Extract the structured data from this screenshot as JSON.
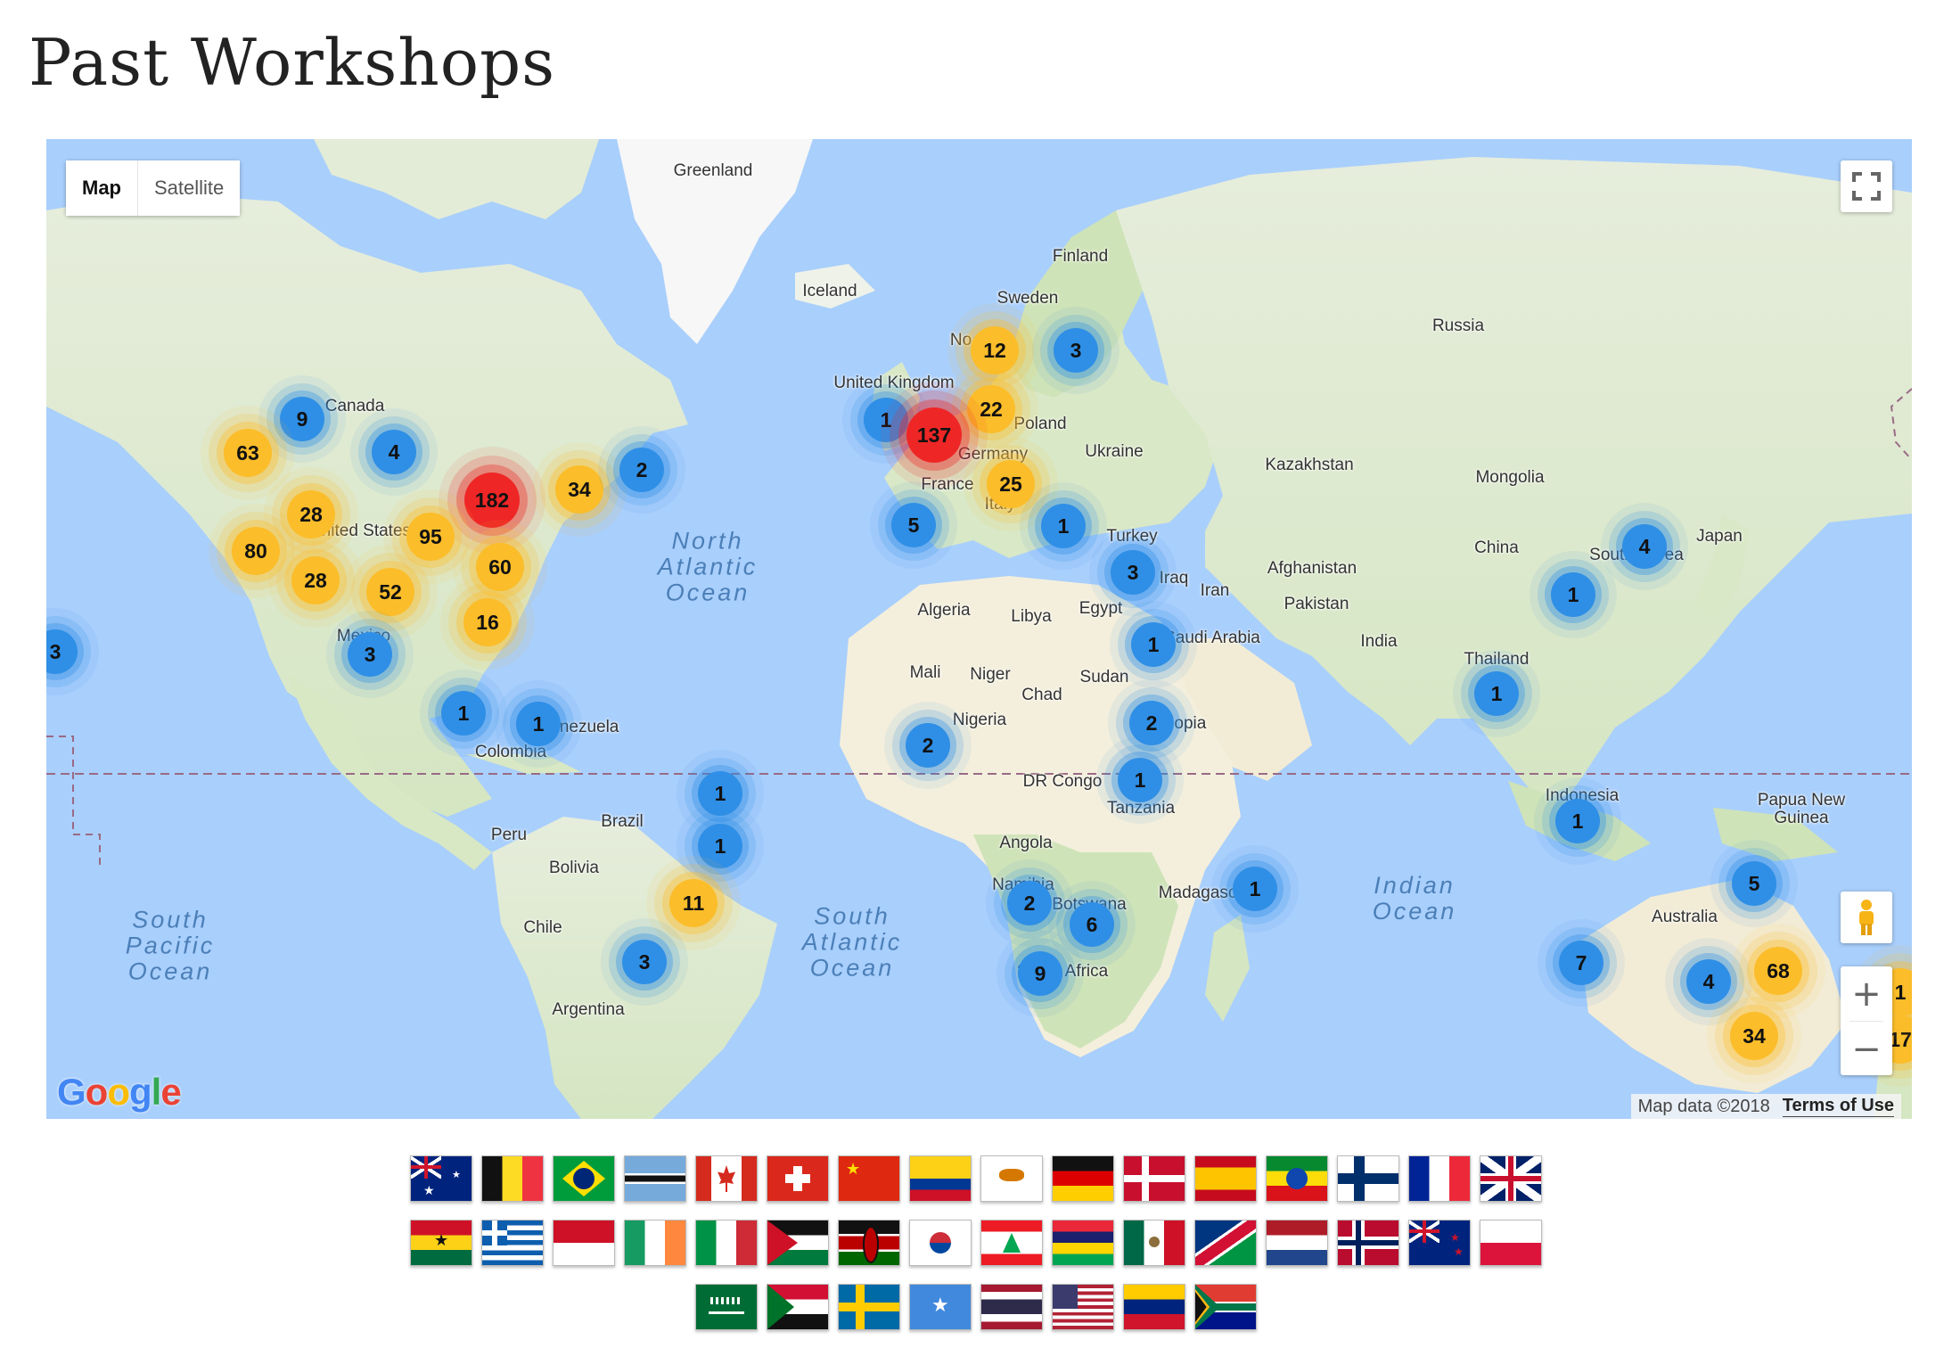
{
  "page": {
    "title": "Past Workshops"
  },
  "map": {
    "type_control": {
      "map_label": "Map",
      "satellite_label": "Satellite",
      "active": "Map"
    },
    "attribution": {
      "data": "Map data ©2018",
      "terms": "Terms of Use"
    },
    "logo_text": "Google",
    "places": [
      "Greenland",
      "Iceland",
      "Finland",
      "Sweden",
      "No",
      "Russia",
      "United Kingdom",
      "Poland",
      "Germany",
      "France",
      "Italy",
      "Ukraine",
      "Kazakhstan",
      "Mongolia",
      "Turkey",
      "Iraq",
      "Iran",
      "Afghanistan",
      "Pakistan",
      "China",
      "Japan",
      "South Korea",
      "India",
      "Thailand",
      "Saudi Arabia",
      "Egypt",
      "Libya",
      "Algeria",
      "Mali",
      "Niger",
      "Chad",
      "Sudan",
      "Nigeria",
      "Ethiopia",
      "DR Congo",
      "Tanzania",
      "Angola",
      "Namibia",
      "Botswana",
      "South Africa",
      "Madagascar",
      "Canada",
      "United States",
      "Mexico",
      "Colombia",
      "Venezuela",
      "Peru",
      "Brazil",
      "Bolivia",
      "Chile",
      "Argentina",
      "Indonesia",
      "Papua New Guinea",
      "Australia"
    ],
    "oceans": [
      "North Atlantic Ocean",
      "South Atlantic Ocean",
      "South Pacific Ocean",
      "Indian Ocean"
    ],
    "clusters": [
      {
        "count": "9",
        "color": "blue"
      },
      {
        "count": "63",
        "color": "yellow"
      },
      {
        "count": "4",
        "color": "blue"
      },
      {
        "count": "182",
        "color": "red"
      },
      {
        "count": "34",
        "color": "yellow"
      },
      {
        "count": "2",
        "color": "blue"
      },
      {
        "count": "28",
        "color": "yellow"
      },
      {
        "count": "95",
        "color": "yellow"
      },
      {
        "count": "80",
        "color": "yellow"
      },
      {
        "count": "28",
        "color": "yellow"
      },
      {
        "count": "52",
        "color": "yellow"
      },
      {
        "count": "60",
        "color": "yellow"
      },
      {
        "count": "16",
        "color": "yellow"
      },
      {
        "count": "3",
        "color": "blue"
      },
      {
        "count": "3",
        "color": "blue"
      },
      {
        "count": "1",
        "color": "blue"
      },
      {
        "count": "1",
        "color": "blue"
      },
      {
        "count": "1",
        "color": "blue"
      },
      {
        "count": "1",
        "color": "blue"
      },
      {
        "count": "11",
        "color": "yellow"
      },
      {
        "count": "3",
        "color": "blue"
      },
      {
        "count": "12",
        "color": "yellow"
      },
      {
        "count": "3",
        "color": "blue"
      },
      {
        "count": "1",
        "color": "blue"
      },
      {
        "count": "22",
        "color": "yellow"
      },
      {
        "count": "137",
        "color": "red"
      },
      {
        "count": "25",
        "color": "yellow"
      },
      {
        "count": "5",
        "color": "blue"
      },
      {
        "count": "1",
        "color": "blue"
      },
      {
        "count": "3",
        "color": "blue"
      },
      {
        "count": "1",
        "color": "blue"
      },
      {
        "count": "2",
        "color": "blue"
      },
      {
        "count": "2",
        "color": "blue"
      },
      {
        "count": "1",
        "color": "blue"
      },
      {
        "count": "2",
        "color": "blue"
      },
      {
        "count": "6",
        "color": "blue"
      },
      {
        "count": "9",
        "color": "blue"
      },
      {
        "count": "1",
        "color": "blue"
      },
      {
        "count": "4",
        "color": "blue"
      },
      {
        "count": "1",
        "color": "blue"
      },
      {
        "count": "1",
        "color": "blue"
      },
      {
        "count": "1",
        "color": "blue"
      },
      {
        "count": "5",
        "color": "blue"
      },
      {
        "count": "7",
        "color": "blue"
      },
      {
        "count": "4",
        "color": "blue"
      },
      {
        "count": "68",
        "color": "yellow"
      },
      {
        "count": "34",
        "color": "yellow"
      },
      {
        "count": "17",
        "color": "yellow"
      },
      {
        "count": "1",
        "color": "yellow"
      }
    ],
    "colors": {
      "water": "#a9cffc",
      "land": "#dfe9cf",
      "forest": "#cfe3b8",
      "desert": "#f4efdc",
      "ice": "#ffffff",
      "cluster_blue": "#2f8fe6",
      "cluster_yellow": "#fbbd2a",
      "cluster_red": "#ef2626"
    }
  },
  "flags": {
    "rows": [
      [
        "Australia",
        "Belgium",
        "Brazil",
        "Botswana",
        "Canada",
        "Switzerland",
        "China",
        "Colombia",
        "Cyprus",
        "Germany",
        "Denmark",
        "Spain",
        "Ethiopia",
        "Finland",
        "France",
        "United Kingdom"
      ],
      [
        "Ghana",
        "Greece",
        "Indonesia",
        "Ireland",
        "Italy",
        "Jordan",
        "Kenya",
        "South Korea",
        "Lebanon",
        "Mauritius",
        "Mexico",
        "Namibia",
        "Netherlands",
        "Norway",
        "New Zealand",
        "Poland"
      ],
      [
        "Saudi Arabia",
        "Sudan",
        "Sweden",
        "Somalia",
        "Thailand",
        "United States",
        "Venezuela",
        "South Africa"
      ]
    ]
  }
}
